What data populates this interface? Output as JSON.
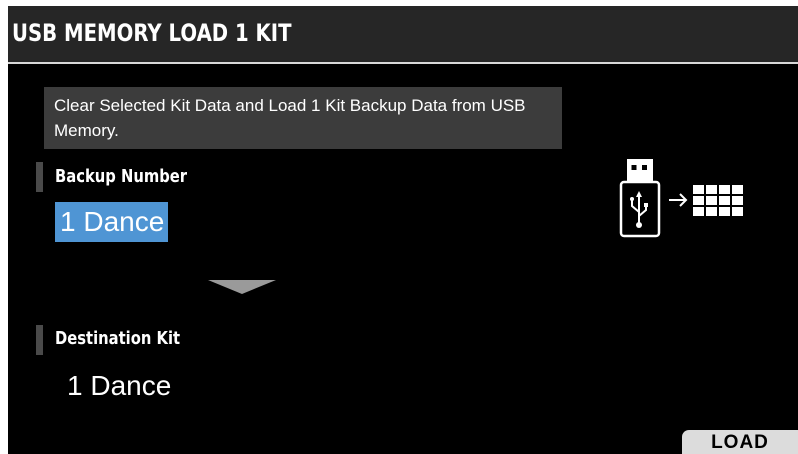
{
  "header": {
    "title": "USB MEMORY LOAD 1 KIT"
  },
  "info": {
    "message": "Clear Selected Kit Data and Load 1 Kit Backup Data from USB Memory."
  },
  "backup": {
    "label": "Backup Number",
    "value": "1 Dance"
  },
  "destination": {
    "label": "Destination Kit",
    "value": "1 Dance"
  },
  "diagram": {
    "source_icon": "usb-memory-icon",
    "arrow_icon": "right-arrow-icon",
    "target_icon": "kit-pads-icon"
  },
  "footer": {
    "load_label": "LOAD"
  },
  "colors": {
    "selection": "#4f95d4",
    "background": "#000000",
    "header": "#262626",
    "button": "#dcdcdc"
  }
}
